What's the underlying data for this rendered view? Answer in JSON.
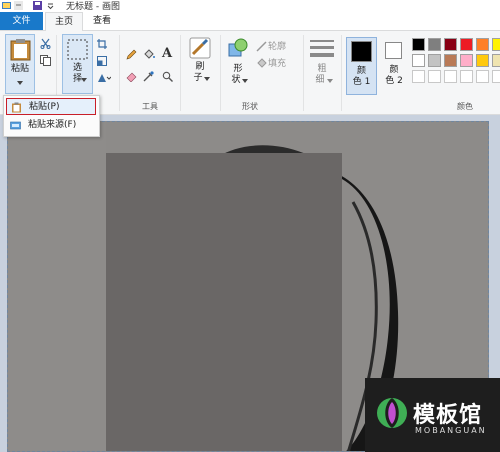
{
  "window": {
    "title": "无标题 - 画图"
  },
  "tabs": {
    "file": "文件",
    "home": "主页",
    "view": "查看"
  },
  "ribbon": {
    "paste_label_1": "粘贴",
    "select_label_1": "选",
    "select_label_2": "择",
    "tools_group": "工具",
    "brushes_label_1": "刷",
    "brushes_label_2": "子",
    "shapes_label_1": "形",
    "shapes_label_2": "状",
    "shapes_group": "形状",
    "outline_label": "轮廓",
    "fill_label": "填充",
    "size_label_1": "粗",
    "size_label_2": "细",
    "color1_label_1": "颜",
    "color1_label_2": "色 1",
    "color2_label_1": "颜",
    "color2_label_2": "色 2",
    "colors_group": "颜色",
    "color1": "#000000",
    "color2": "#ffffff",
    "palette_row1": [
      "#000000",
      "#7f7f7f",
      "#880015",
      "#ed1c24",
      "#ff7f27",
      "#fff200"
    ],
    "palette_row2": [
      "#ffffff",
      "#c3c3c3",
      "#b97a57",
      "#ffaec9",
      "#ffc90e",
      "#efe4b0"
    ]
  },
  "paste_menu": {
    "paste": "粘贴(P)",
    "paste_from": "粘贴来源(F)"
  },
  "watermark": {
    "text": "模板馆",
    "sub": "MOBANGUAN"
  }
}
